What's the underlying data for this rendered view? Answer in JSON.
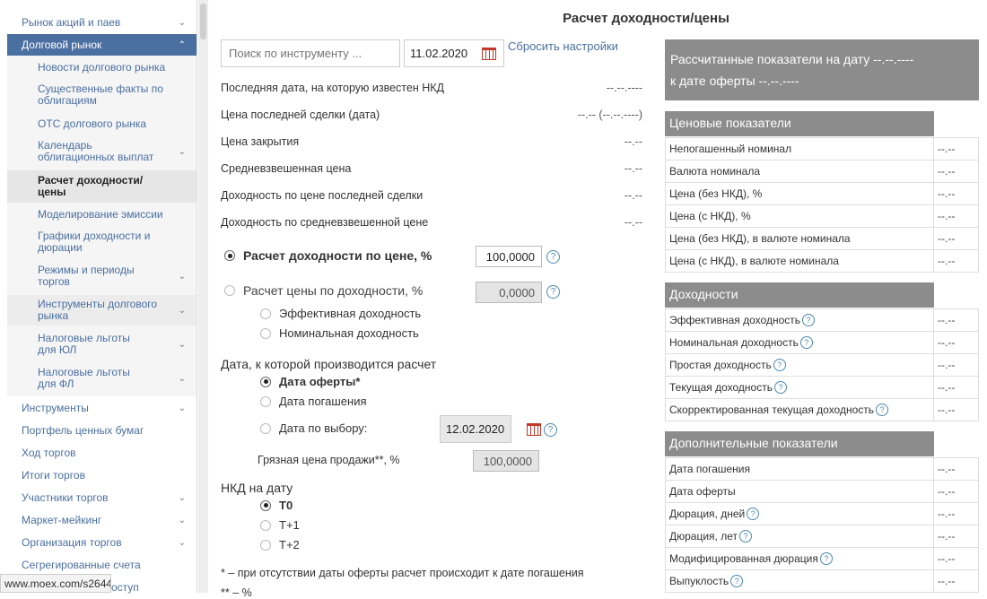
{
  "sidebar": {
    "items": [
      {
        "label": "Рынок акций и паев",
        "chevron": "⌄"
      },
      {
        "label": "Долговой рынок",
        "chevron": "⌃"
      },
      {
        "label": "Новости долгового рынка"
      },
      {
        "label": "Существенные факты по облигациям"
      },
      {
        "label": "ОТС долгового рынка"
      },
      {
        "label": "Календарь облигационных выплат",
        "chevron": "⌄"
      },
      {
        "label": "Расчет доходности/ цены"
      },
      {
        "label": "Моделирование эмиссии"
      },
      {
        "label": "Графики доходности и дюрации"
      },
      {
        "label": "Режимы и периоды торгов",
        "chevron": "⌄"
      },
      {
        "label": "Инструменты долгового рынка",
        "chevron": "⌄"
      },
      {
        "label": "Налоговые льготы для ЮЛ",
        "chevron": "⌄"
      },
      {
        "label": "Налоговые льготы для ФЛ",
        "chevron": "⌄"
      },
      {
        "label": "Инструменты",
        "chevron": "⌄"
      },
      {
        "label": "Портфель ценных бумаг"
      },
      {
        "label": "Ход торгов"
      },
      {
        "label": "Итоги торгов"
      },
      {
        "label": "Участники торгов",
        "chevron": "⌄"
      },
      {
        "label": "Маркет-мейкинг",
        "chevron": "⌄"
      },
      {
        "label": "Организация торгов",
        "chevron": "⌄"
      },
      {
        "label": "Сегрегированные счета"
      },
      {
        "label": "оступ"
      }
    ],
    "status_url": "www.moex.com/s2644"
  },
  "main": {
    "title": "Расчет доходности/цены",
    "search_placeholder": "Поиск по инструменту ...",
    "date": "11.02.2020",
    "reset": "Сбросить настройки",
    "info": [
      {
        "label": "Последняя дата, на которую известен НКД",
        "value": "--.--.----"
      },
      {
        "label": "Цена последней сделки (дата)",
        "value": "--.-- (--.--.----)"
      },
      {
        "label": "Цена закрытия",
        "value": "--.--"
      },
      {
        "label": "Средневзвешенная цена",
        "value": "--.--"
      },
      {
        "label": "Доходность по цене последней сделки",
        "value": "--.--"
      },
      {
        "label": "Доходность по средневзвешенной цене",
        "value": "--.--"
      }
    ],
    "calc_by_price": "Расчет доходности по цене, %",
    "price_value": "100,0000",
    "calc_by_yield": "Расчет цены по доходности, %",
    "yield_value": "0,0000",
    "eff_yield": "Эффективная доходность",
    "nom_yield": "Номинальная доходность",
    "calc_date_label": "Дата, к которой производится расчет",
    "offer_date": "Дата оферты*",
    "maturity_date": "Дата погашения",
    "custom_date": "Дата по выбору:",
    "custom_date_value": "12.02.2020",
    "dirty_price_label": "Грязная цена продажи**, %",
    "dirty_price_value": "100,0000",
    "nkd_label": "НКД на дату",
    "t0": "T0",
    "t1": "T+1",
    "t2": "T+2",
    "footnote1": "* – при отсутствии даты оферты расчет происходит к дате погашения",
    "footnote2": "** – %",
    "help": "?"
  },
  "right": {
    "header_line1": "Рассчитанные показатели на дату --.--.----",
    "header_line2": "к дате оферты --.--.----",
    "price_section": "Ценовые показатели",
    "price_rows": [
      {
        "label": "Непогашенный номинал",
        "value": "--.--"
      },
      {
        "label": "Валюта номинала",
        "value": "--.--"
      },
      {
        "label": "Цена (без НКД), %",
        "value": "--.--"
      },
      {
        "label": "Цена (с НКД), %",
        "value": "--.--"
      },
      {
        "label": "Цена (без НКД), в валюте номинала",
        "value": "--.--"
      },
      {
        "label": "Цена (с НКД), в валюте номинала",
        "value": "--.--"
      }
    ],
    "yield_section": "Доходности",
    "yield_rows": [
      {
        "label": "Эффективная доходность",
        "value": "--.--"
      },
      {
        "label": "Номинальная доходность",
        "value": "--.--"
      },
      {
        "label": "Простая доходность",
        "value": "--.--"
      },
      {
        "label": "Текущая доходность",
        "value": "--.--"
      },
      {
        "label": "Скорректированная текущая доходность",
        "value": "--.--"
      }
    ],
    "extra_section": "Дополнительные показатели",
    "extra_rows": [
      {
        "label": "Дата погашения",
        "value": "--.--"
      },
      {
        "label": "Дата оферты",
        "value": "--.--"
      },
      {
        "label": "Дюрация, дней",
        "value": "--.--"
      },
      {
        "label": "Дюрация, лет",
        "value": "--.--"
      },
      {
        "label": "Модифицированная дюрация",
        "value": "--.--"
      },
      {
        "label": "Выпуклость",
        "value": "--.--"
      }
    ]
  }
}
